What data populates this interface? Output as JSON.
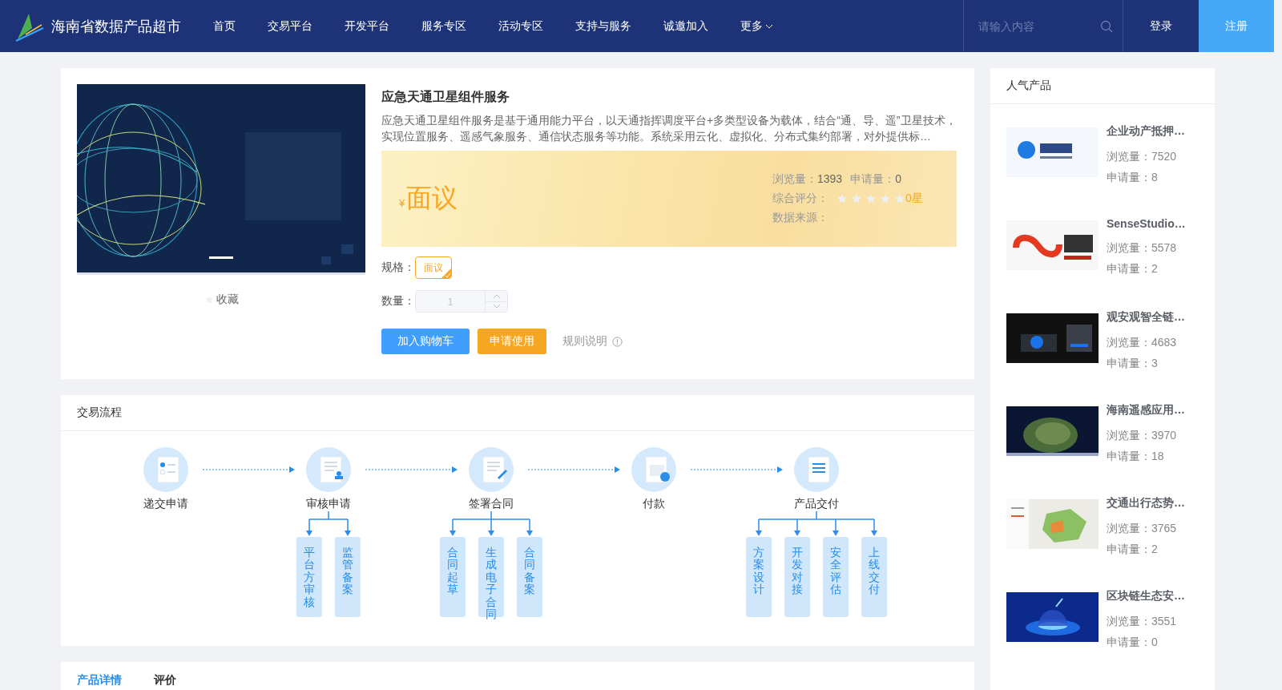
{
  "header": {
    "site_title": "海南省数据产品超市",
    "nav": [
      {
        "label": "首页"
      },
      {
        "label": "交易平台"
      },
      {
        "label": "开发平台"
      },
      {
        "label": "服务专区"
      },
      {
        "label": "活动专区"
      },
      {
        "label": "支持与服务"
      },
      {
        "label": "诚邀加入"
      }
    ],
    "more": "更多",
    "search": {
      "placeholder": "请输入内容"
    },
    "login": "登录",
    "register": "注册"
  },
  "product": {
    "favorite": "收藏",
    "title": "应急天通卫星组件服务",
    "description": "应急天通卫星组件服务是基于通用能力平台，以天通指挥调度平台+多类型设备为载体，结合“通、导、遥”卫星技术，实现位置服务、遥感气象服务、通信状态服务等功能。系统采用云化、虚拟化、分布式集约部署，对外提供标…",
    "price_symbol": "¥",
    "price": "面议",
    "views_label": "浏览量：",
    "views": "1393",
    "applies_label": "申请量：",
    "applies": "0",
    "rating_label": "综合评分：",
    "stars": 0,
    "rating_text": "0星",
    "source_label": "数据来源：",
    "spec_label": "规格：",
    "specs": [
      {
        "label": "面议",
        "selected": true
      }
    ],
    "quantity_label": "数量：",
    "quantity": "1",
    "cart_button": "加入购物车",
    "apply_button": "申请使用",
    "rules": "规则说明"
  },
  "flow": {
    "title": "交易流程",
    "steps": [
      {
        "label": "递交申请",
        "kind": "submit"
      },
      {
        "label": "审核申请",
        "kind": "review",
        "children": [
          {
            "label": "平台方审核"
          },
          {
            "label": "监管备案"
          }
        ]
      },
      {
        "label": "签署合同",
        "kind": "sign",
        "children": [
          {
            "label": "合同起草"
          },
          {
            "label": "生成电子合同"
          },
          {
            "label": "合同备案"
          }
        ]
      },
      {
        "label": "付款",
        "kind": "pay"
      },
      {
        "label": "产品交付",
        "kind": "deliver",
        "children": [
          {
            "label": "方案设计"
          },
          {
            "label": "开发对接"
          },
          {
            "label": "安全评估"
          },
          {
            "label": "上线交付"
          }
        ]
      }
    ]
  },
  "tabs": [
    {
      "label": "产品详情",
      "selected": true
    },
    {
      "label": "评价",
      "selected": false
    }
  ],
  "sidebar": {
    "title": "人气产品",
    "items": [
      {
        "title": "企业动产抵押…",
        "views": "浏览量：7520",
        "applies": "申请量：8"
      },
      {
        "title": "SenseStudio…",
        "views": "浏览量：5578",
        "applies": "申请量：2"
      },
      {
        "title": "观安观智全链…",
        "views": "浏览量：4683",
        "applies": "申请量：3"
      },
      {
        "title": "海南遥感应用…",
        "views": "浏览量：3970",
        "applies": "申请量：18"
      },
      {
        "title": "交通出行态势…",
        "views": "浏览量：3765",
        "applies": "申请量：2"
      },
      {
        "title": "区块链生态安…",
        "views": "浏览量：3551",
        "applies": "申请量：0"
      }
    ]
  }
}
